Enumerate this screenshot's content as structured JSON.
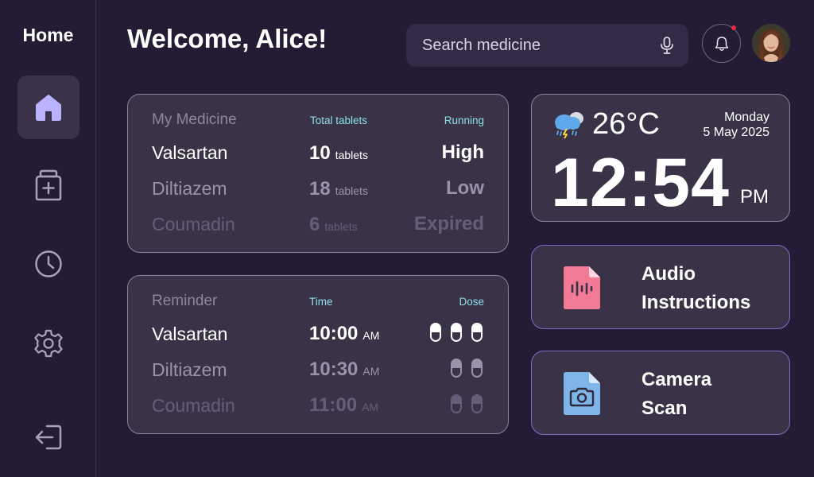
{
  "sidebar": {
    "title": "Home",
    "items": [
      {
        "name": "home",
        "icon": "home-icon",
        "active": true
      },
      {
        "name": "medicine",
        "icon": "medicine-bottle-icon",
        "active": false
      },
      {
        "name": "history",
        "icon": "clock-icon",
        "active": false
      },
      {
        "name": "settings",
        "icon": "gear-icon",
        "active": false
      },
      {
        "name": "logout",
        "icon": "logout-icon",
        "active": false
      }
    ]
  },
  "header": {
    "welcome": "Welcome, Alice!",
    "search_placeholder": "Search medicine",
    "notification_icon": "bell-icon",
    "notification_dot_color": "#e32b3c"
  },
  "medicine": {
    "title": "My Medicine",
    "col_tablets": "Total tablets",
    "col_running": "Running",
    "rows": [
      {
        "name": "Valsartan",
        "count": "10",
        "unit": "tablets",
        "status": "High"
      },
      {
        "name": "Diltiazem",
        "count": "18",
        "unit": "tablets",
        "status": "Low"
      },
      {
        "name": "Coumadin",
        "count": "6",
        "unit": "tablets",
        "status": "Expired"
      }
    ]
  },
  "reminder": {
    "title": "Reminder",
    "col_time": "Time",
    "col_dose": "Dose",
    "rows": [
      {
        "name": "Valsartan",
        "time": "10:00",
        "ampm": "AM",
        "dose": 3
      },
      {
        "name": "Diltiazem",
        "time": "10:30",
        "ampm": "AM",
        "dose": 2
      },
      {
        "name": "Coumadin",
        "time": "11:00",
        "ampm": "AM",
        "dose": 2
      }
    ]
  },
  "weather": {
    "icon": "thunderstorm-cloud-icon",
    "temperature": "26°C",
    "day": "Monday",
    "date": "5 May 2025",
    "time": "12:54",
    "ampm": "PM"
  },
  "actions": {
    "audio": {
      "label_line1": "Audio",
      "label_line2": "Instructions",
      "icon": "audio-file-icon",
      "color": "#f27a97"
    },
    "camera": {
      "label_line1": "Camera",
      "label_line2": "Scan",
      "icon": "camera-file-icon",
      "color": "#7fb5e8"
    }
  },
  "colors": {
    "background": "#231c34",
    "card": "#3a3348",
    "accent_cyan": "#8ee0e8",
    "nav_active_icon": "#b8b2ff"
  }
}
